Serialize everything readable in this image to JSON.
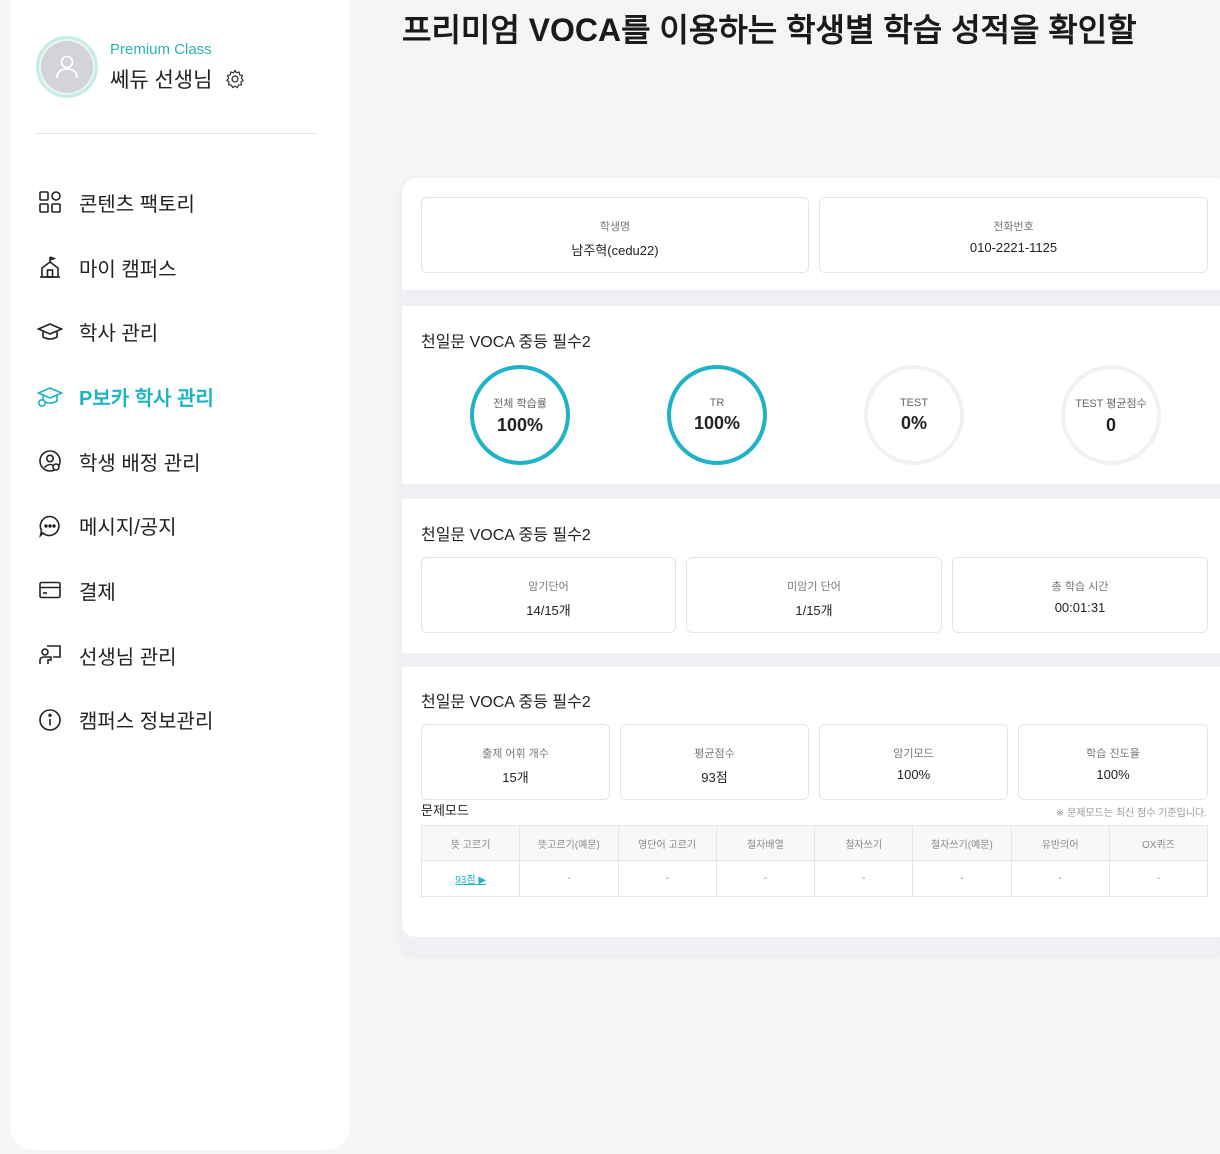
{
  "profile": {
    "class_label": "Premium Class",
    "teacher_name": "쎄듀 선생님"
  },
  "menu": [
    {
      "label": "콘텐츠 팩토리",
      "icon": "grid-icon",
      "active": false
    },
    {
      "label": "마이 캠퍼스",
      "icon": "school-icon",
      "active": false
    },
    {
      "label": "학사 관리",
      "icon": "graduation-cap-icon",
      "active": false
    },
    {
      "label": "P보카 학사 관리",
      "icon": "graduation-cap-badge-icon",
      "active": true
    },
    {
      "label": "학생 배정 관리",
      "icon": "user-assign-icon",
      "active": false
    },
    {
      "label": "메시지/공지",
      "icon": "chat-bubble-icon",
      "active": false
    },
    {
      "label": "결제",
      "icon": "credit-card-icon",
      "active": false
    },
    {
      "label": "선생님 관리",
      "icon": "teacher-board-icon",
      "active": false
    },
    {
      "label": "캠퍼스 정보관리",
      "icon": "info-icon",
      "active": false
    }
  ],
  "accent_color": "#1fb3c7",
  "heading": "프리미엄 VOCA를 이용하는 학생별 학습 성적을 확인할",
  "student": {
    "name_label": "학생명",
    "name_value": "남주혁(cedu22)",
    "phone_label": "전화번호",
    "phone_value": "010-2221-1125"
  },
  "progress": {
    "title": "천일문 VOCA 중등 필수2",
    "rings": [
      {
        "label": "전체 학습률",
        "value": "100%",
        "percent": 100
      },
      {
        "label": "TR",
        "value": "100%",
        "percent": 100
      },
      {
        "label": "TEST",
        "value": "0%",
        "percent": 0
      },
      {
        "label": "TEST 평균점수",
        "value": "0",
        "percent": 0
      }
    ]
  },
  "words": {
    "title": "천일문 VOCA 중등 필수2",
    "cards": [
      {
        "label": "암기단어",
        "value": "14/15개"
      },
      {
        "label": "미암기 단어",
        "value": "1/15개"
      },
      {
        "label": "총 학습 시간",
        "value": "00:01:31"
      }
    ]
  },
  "test": {
    "title": "천일문 VOCA 중등 필수2",
    "cards": [
      {
        "label": "출제 어휘 개수",
        "value": "15개"
      },
      {
        "label": "평균점수",
        "value": "93점"
      },
      {
        "label": "암기모드",
        "value": "100%"
      },
      {
        "label": "학습 진도율",
        "value": "100%"
      }
    ],
    "mode_title": "문제모드",
    "mode_note": "※ 문제모드는 최신 점수 기준입니다.",
    "mode_headers": [
      "뜻 고르기",
      "뜻고르기(예문)",
      "영단어 고르기",
      "철자배열",
      "철자쓰기",
      "철자쓰기(예문)",
      "유반의어",
      "OX퀴즈"
    ],
    "mode_values": [
      "93점 ▶",
      "-",
      "-",
      "-",
      "-",
      "-",
      "-",
      "-"
    ]
  }
}
